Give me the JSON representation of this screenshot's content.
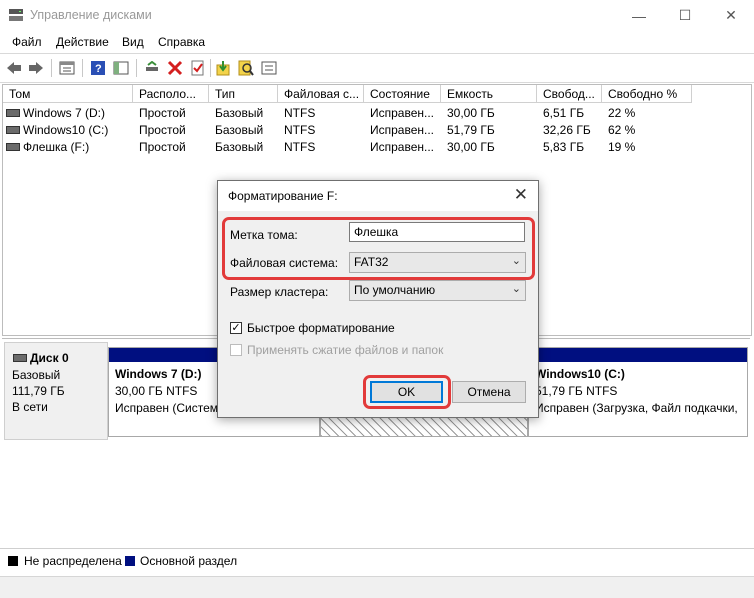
{
  "window": {
    "title": "Управление дисками",
    "min_glyph": "—",
    "max_glyph": "☐",
    "close_glyph": "✕"
  },
  "menu": [
    "Файл",
    "Действие",
    "Вид",
    "Справка"
  ],
  "toolbar_icons": [
    "back-arrow-icon",
    "forward-arrow-icon",
    "properties-icon",
    "help-icon",
    "show-pane-icon",
    "connect-drive-icon",
    "delete-icon",
    "check-icon",
    "import-icon",
    "search-icon",
    "list-view-icon"
  ],
  "volumes": {
    "columns": [
      "Том",
      "Располо...",
      "Тип",
      "Файловая с...",
      "Состояние",
      "Емкость",
      "Свобод...",
      "Свободно %"
    ],
    "rows": [
      [
        "Windows 7 (D:)",
        "Простой",
        "Базовый",
        "NTFS",
        "Исправен...",
        "30,00 ГБ",
        "6,51 ГБ",
        "22 %"
      ],
      [
        "Windows10 (C:)",
        "Простой",
        "Базовый",
        "NTFS",
        "Исправен...",
        "51,79 ГБ",
        "32,26 ГБ",
        "62 %"
      ],
      [
        "Флешка (F:)",
        "Простой",
        "Базовый",
        "NTFS",
        "Исправен...",
        "30,00 ГБ",
        "5,83 ГБ",
        "19 %"
      ]
    ]
  },
  "disk": {
    "name": "Диск 0",
    "type": "Базовый",
    "size": "111,79 ГБ",
    "status": "В сети",
    "partitions": [
      {
        "name": "Windows 7  (D:)",
        "info": "30,00 ГБ NTFS",
        "status": "Исправен (Систем"
      },
      {
        "name": "Windows10  (C:)",
        "info": "51,79 ГБ NTFS",
        "status": "Исправен (Загрузка, Файл подкачки, "
      }
    ]
  },
  "legend": [
    {
      "label": "Не распределена",
      "color": "#000000"
    },
    {
      "label": "Основной раздел",
      "color": "#000f80"
    }
  ],
  "dialog": {
    "title": "Форматирование F:",
    "close_glyph": "✕",
    "volume_label_caption": "Метка тома:",
    "volume_label_value": "Флешка",
    "fs_caption": "Файловая система:",
    "fs_value": "FAT32",
    "cluster_caption": "Размер кластера:",
    "cluster_value": "По умолчанию",
    "quick_format": "Быстрое форматирование",
    "quick_format_checked": true,
    "compression": "Применять сжатие файлов и папок",
    "compression_checked": false,
    "ok": "OK",
    "cancel": "Отмена",
    "highlight_color": "#e23a3a"
  }
}
